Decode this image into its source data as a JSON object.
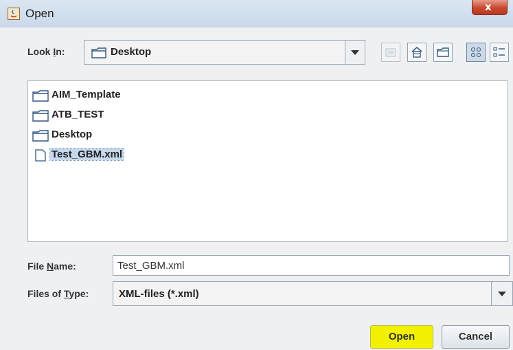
{
  "window": {
    "title": "Open",
    "close_glyph": "x"
  },
  "look_in": {
    "label": "Look In:",
    "value": "Desktop"
  },
  "toolbar": {
    "buttons": [
      {
        "name": "up-one-level-icon"
      },
      {
        "name": "home-icon"
      },
      {
        "name": "new-folder-icon"
      },
      {
        "name": "list-view-icon",
        "active": true
      },
      {
        "name": "details-view-icon"
      }
    ]
  },
  "files": [
    {
      "name": "AIM_Template",
      "type": "folder"
    },
    {
      "name": "ATB_TEST",
      "type": "folder"
    },
    {
      "name": "Desktop",
      "type": "folder"
    },
    {
      "name": "Test_GBM.xml",
      "type": "file",
      "selected": true
    }
  ],
  "file_name": {
    "label": "File Name:",
    "value": "Test_GBM.xml"
  },
  "file_type": {
    "label": "Files of Type:",
    "value": "XML-files (*.xml)"
  },
  "buttons": {
    "open": "Open",
    "cancel": "Cancel"
  },
  "colors": {
    "open_button": "#f2f200",
    "selection": "#c6d8ec",
    "close_button": "#c7472e"
  }
}
